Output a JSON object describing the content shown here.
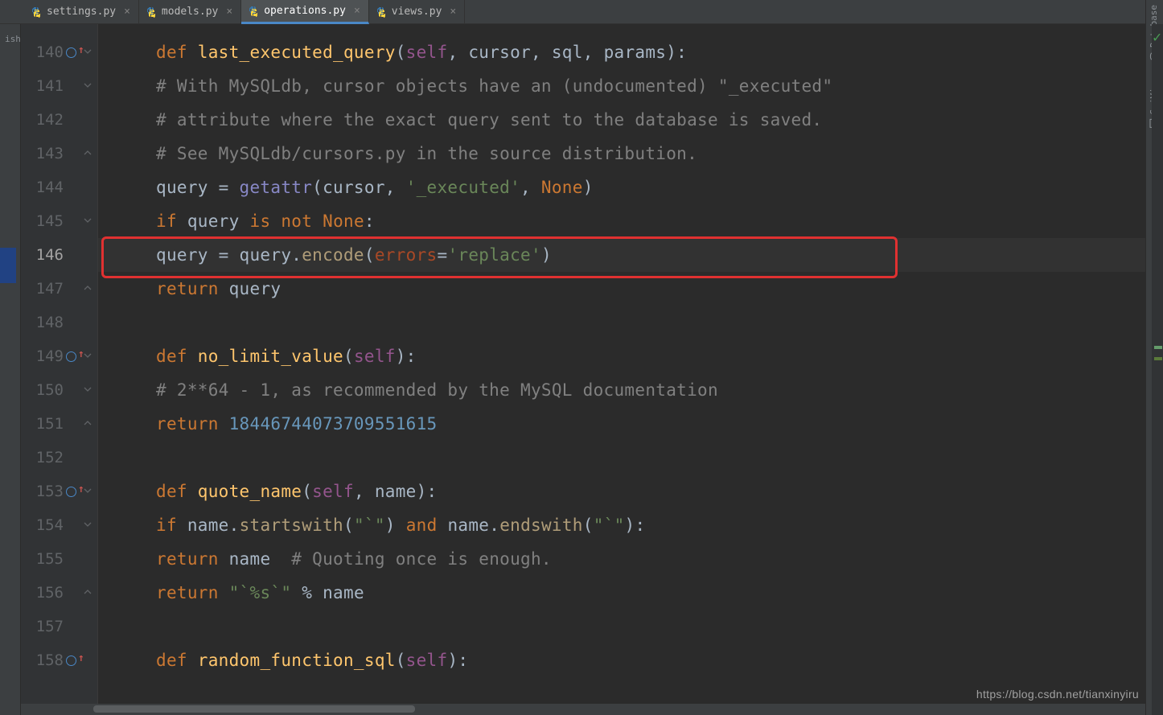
{
  "left_stripe": {
    "label": "ish"
  },
  "tabs": [
    {
      "name": "settings.py",
      "active": false
    },
    {
      "name": "models.py",
      "active": false
    },
    {
      "name": "operations.py",
      "active": true
    },
    {
      "name": "views.py",
      "active": false
    }
  ],
  "right_tools": [
    {
      "label": "Database",
      "icon": "database-icon"
    },
    {
      "label": "SciView",
      "icon": "sciview-icon"
    }
  ],
  "gutter": {
    "start": 140,
    "end": 158,
    "override_lines": [
      140,
      149,
      153,
      158
    ],
    "fold_open_lines": [
      140,
      141,
      145,
      149,
      150,
      153,
      154
    ],
    "fold_close_lines": [
      143,
      147,
      151,
      156
    ],
    "current_line": 146
  },
  "code": {
    "140": [
      {
        "t": "keyword",
        "v": "def "
      },
      {
        "t": "def",
        "v": "last_executed_query"
      },
      {
        "t": "default",
        "v": "("
      },
      {
        "t": "param-self",
        "v": "self"
      },
      {
        "t": "default",
        "v": ", cursor, sql, params):"
      }
    ],
    "141": [
      {
        "t": "indent",
        "v": "    "
      },
      {
        "t": "comment",
        "v": "# With MySQLdb, cursor objects have an (undocumented) \"_executed\""
      }
    ],
    "142": [
      {
        "t": "indent",
        "v": "    "
      },
      {
        "t": "comment",
        "v": "# attribute where the exact query sent to the database is saved."
      }
    ],
    "143": [
      {
        "t": "indent",
        "v": "    "
      },
      {
        "t": "comment",
        "v": "# See MySQLdb/cursors.py in the source distribution."
      }
    ],
    "144": [
      {
        "t": "indent",
        "v": "    "
      },
      {
        "t": "ident",
        "v": "query = "
      },
      {
        "t": "builtin",
        "v": "getattr"
      },
      {
        "t": "default",
        "v": "(cursor, "
      },
      {
        "t": "string",
        "v": "'_executed'"
      },
      {
        "t": "default",
        "v": ", "
      },
      {
        "t": "keyword",
        "v": "None"
      },
      {
        "t": "default",
        "v": ")"
      }
    ],
    "145": [
      {
        "t": "indent",
        "v": "    "
      },
      {
        "t": "keyword",
        "v": "if "
      },
      {
        "t": "ident",
        "v": "query "
      },
      {
        "t": "keyword",
        "v": "is not "
      },
      {
        "t": "keyword",
        "v": "None"
      },
      {
        "t": "default",
        "v": ":"
      }
    ],
    "146": [
      {
        "t": "indent",
        "v": "        "
      },
      {
        "t": "ident",
        "v": "query = query."
      },
      {
        "t": "call",
        "v": "encode"
      },
      {
        "t": "default",
        "v": "("
      },
      {
        "t": "kwarg",
        "v": "errors"
      },
      {
        "t": "default",
        "v": "="
      },
      {
        "t": "string",
        "v": "'replace'"
      },
      {
        "t": "default",
        "v": ")"
      }
    ],
    "147": [
      {
        "t": "indent",
        "v": "    "
      },
      {
        "t": "keyword",
        "v": "return "
      },
      {
        "t": "ident",
        "v": "query"
      }
    ],
    "148": [],
    "149": [
      {
        "t": "keyword",
        "v": "def "
      },
      {
        "t": "def",
        "v": "no_limit_value"
      },
      {
        "t": "default",
        "v": "("
      },
      {
        "t": "param-self",
        "v": "self"
      },
      {
        "t": "default",
        "v": "):"
      }
    ],
    "150": [
      {
        "t": "indent",
        "v": "    "
      },
      {
        "t": "comment",
        "v": "# 2**64 - 1, as recommended by the MySQL documentation"
      }
    ],
    "151": [
      {
        "t": "indent",
        "v": "    "
      },
      {
        "t": "keyword",
        "v": "return "
      },
      {
        "t": "number",
        "v": "18446744073709551615"
      }
    ],
    "152": [],
    "153": [
      {
        "t": "keyword",
        "v": "def "
      },
      {
        "t": "def",
        "v": "quote_name"
      },
      {
        "t": "default",
        "v": "("
      },
      {
        "t": "param-self",
        "v": "self"
      },
      {
        "t": "default",
        "v": ", name):"
      }
    ],
    "154": [
      {
        "t": "indent",
        "v": "    "
      },
      {
        "t": "keyword",
        "v": "if "
      },
      {
        "t": "ident",
        "v": "name."
      },
      {
        "t": "call",
        "v": "startswith"
      },
      {
        "t": "default",
        "v": "("
      },
      {
        "t": "string",
        "v": "\"`\""
      },
      {
        "t": "default",
        "v": ") "
      },
      {
        "t": "keyword",
        "v": "and "
      },
      {
        "t": "ident",
        "v": "name."
      },
      {
        "t": "call",
        "v": "endswith"
      },
      {
        "t": "default",
        "v": "("
      },
      {
        "t": "string",
        "v": "\"`\""
      },
      {
        "t": "default",
        "v": "):"
      }
    ],
    "155": [
      {
        "t": "indent",
        "v": "        "
      },
      {
        "t": "keyword",
        "v": "return "
      },
      {
        "t": "ident",
        "v": "name  "
      },
      {
        "t": "comment",
        "v": "# Quoting once is enough."
      }
    ],
    "156": [
      {
        "t": "indent",
        "v": "    "
      },
      {
        "t": "keyword",
        "v": "return "
      },
      {
        "t": "string",
        "v": "\"`%s`\""
      },
      {
        "t": "ident",
        "v": " % name"
      }
    ],
    "157": [],
    "158": [
      {
        "t": "keyword",
        "v": "def "
      },
      {
        "t": "def",
        "v": "random_function_sql"
      },
      {
        "t": "default",
        "v": "("
      },
      {
        "t": "param-self",
        "v": "self"
      },
      {
        "t": "default",
        "v": "):"
      }
    ]
  },
  "watermark": "https://blog.csdn.net/tianxinyiru"
}
